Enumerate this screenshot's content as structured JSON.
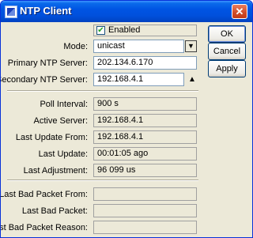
{
  "window": {
    "title": "NTP Client",
    "close_glyph": "✕"
  },
  "enabled": {
    "label": "Enabled",
    "checked": true,
    "check_glyph": "✔"
  },
  "settings": {
    "mode_label": "Mode:",
    "mode_value": "unicast",
    "mode_dropdown_glyph": "▼",
    "primary_label": "Primary NTP Server:",
    "primary_value": "202.134.6.170",
    "secondary_label": "Secondary NTP Server:",
    "secondary_value": "192.168.4.1",
    "secondary_arrow_glyph": "▲"
  },
  "status": {
    "poll_interval_label": "Poll Interval:",
    "poll_interval_value": "900 s",
    "active_server_label": "Active Server:",
    "active_server_value": "192.168.4.1",
    "last_update_from_label": "Last Update From:",
    "last_update_from_value": "192.168.4.1",
    "last_update_label": "Last Update:",
    "last_update_value": "00:01:05 ago",
    "last_adjustment_label": "Last Adjustment:",
    "last_adjustment_value": "96 099 us"
  },
  "bad_packet": {
    "from_label": "Last Bad Packet From:",
    "from_value": "",
    "packet_label": "Last Bad Packet:",
    "packet_value": "",
    "reason_label": "Last Bad Packet Reason:",
    "reason_value": ""
  },
  "buttons": {
    "ok": "OK",
    "cancel": "Cancel",
    "apply": "Apply"
  }
}
